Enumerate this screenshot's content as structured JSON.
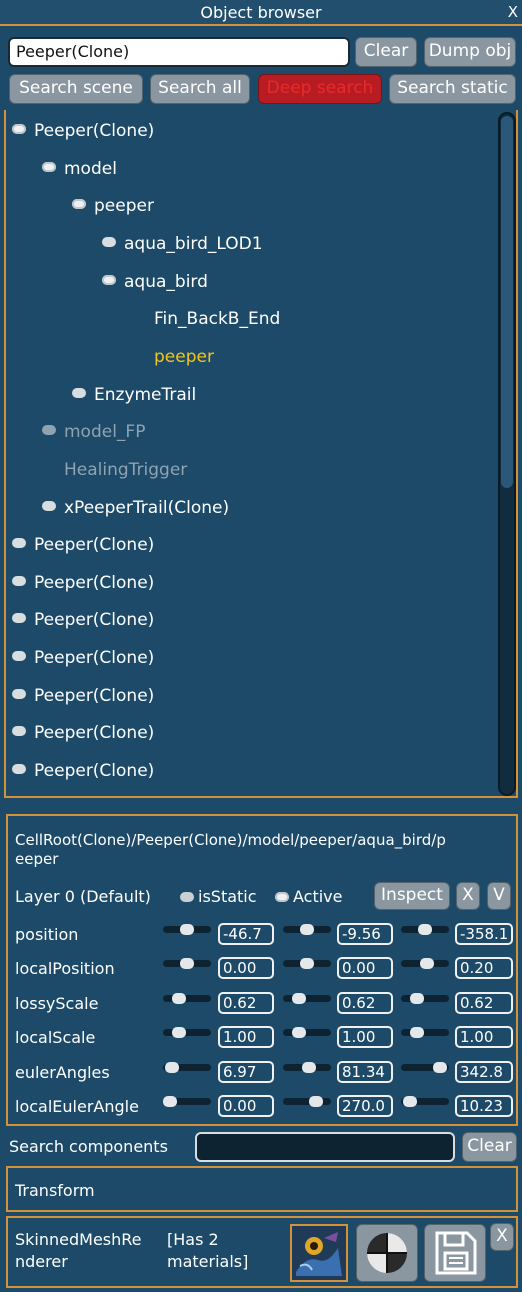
{
  "window": {
    "title": "Object browser",
    "close_label": "X"
  },
  "search": {
    "value": "Peeper(Clone)",
    "clear_label": "Clear",
    "dump_label": "Dump obj"
  },
  "modes": {
    "scene": "Search scene",
    "all": "Search all",
    "deep": "Deep search",
    "static": "Search static"
  },
  "tree": [
    {
      "label": "Peeper(Clone)",
      "level": 0,
      "check": "on",
      "style": "normal"
    },
    {
      "label": "model",
      "level": 1,
      "check": "on",
      "style": "normal"
    },
    {
      "label": "peeper",
      "level": 2,
      "check": "on",
      "style": "normal"
    },
    {
      "label": "aqua_bird_LOD1",
      "level": 3,
      "check": "off",
      "style": "normal"
    },
    {
      "label": "aqua_bird",
      "level": 3,
      "check": "on",
      "style": "normal"
    },
    {
      "label": "Fin_BackB_End",
      "level": 4,
      "check": "none",
      "style": "normal"
    },
    {
      "label": "peeper",
      "level": 4,
      "check": "none",
      "style": "selected"
    },
    {
      "label": "EnzymeTrail",
      "level": 2,
      "check": "off",
      "style": "normal"
    },
    {
      "label": "model_FP",
      "level": 1,
      "check": "off",
      "style": "inactive"
    },
    {
      "label": "HealingTrigger",
      "level": 1,
      "check": "none",
      "style": "inactive"
    },
    {
      "label": "xPeeperTrail(Clone)",
      "level": 1,
      "check": "off",
      "style": "normal"
    },
    {
      "label": "Peeper(Clone)",
      "level": 0,
      "check": "off",
      "style": "normal"
    },
    {
      "label": "Peeper(Clone)",
      "level": 0,
      "check": "off",
      "style": "normal"
    },
    {
      "label": "Peeper(Clone)",
      "level": 0,
      "check": "off",
      "style": "normal"
    },
    {
      "label": "Peeper(Clone)",
      "level": 0,
      "check": "off",
      "style": "normal"
    },
    {
      "label": "Peeper(Clone)",
      "level": 0,
      "check": "off",
      "style": "normal"
    },
    {
      "label": "Peeper(Clone)",
      "level": 0,
      "check": "off",
      "style": "normal"
    },
    {
      "label": "Peeper(Clone)",
      "level": 0,
      "check": "off",
      "style": "normal"
    }
  ],
  "inspector": {
    "path_line1": "CellRoot(Clone)/Peeper(Clone)/model/peeper/aqua_bird/p",
    "path_line2": "eeper",
    "layer": "Layer 0 (Default)",
    "is_static": "isStatic",
    "active": "Active",
    "inspect_label": "Inspect",
    "x_label": "X",
    "v_label": "V",
    "rows": [
      {
        "label": "position",
        "values": [
          "-46.7",
          "-9.56",
          "-358.1"
        ],
        "sliders": [
          0.5,
          0.5,
          0.5
        ]
      },
      {
        "label": "localPosition",
        "values": [
          "0.00",
          "0.00",
          "0.20"
        ],
        "sliders": [
          0.5,
          0.5,
          0.55
        ]
      },
      {
        "label": "lossyScale",
        "values": [
          "0.62",
          "0.62",
          "0.62"
        ],
        "sliders": [
          0.25,
          0.25,
          0.25
        ]
      },
      {
        "label": "localScale",
        "values": [
          "1.00",
          "1.00",
          "1.00"
        ],
        "sliders": [
          0.25,
          0.25,
          0.25
        ]
      },
      {
        "label": "eulerAngles",
        "values": [
          "6.97",
          "81.34",
          "342.8"
        ],
        "sliders": [
          0.05,
          0.55,
          0.95
        ]
      },
      {
        "label": "localEulerAngle",
        "values": [
          "0.00",
          "270.0",
          "10.23"
        ],
        "sliders": [
          0.0,
          0.75,
          0.05
        ]
      }
    ]
  },
  "components": {
    "search_label": "Search components",
    "search_value": "",
    "clear_label": "Clear",
    "transform_label": "Transform",
    "renderer_line1": "SkinnedMeshRe",
    "renderer_line2": "nderer",
    "materials_line1": "[Has 2",
    "materials_line2": "materials]",
    "remove_label": "X"
  },
  "colors": {
    "accent": "#d3923a",
    "selected": "#f5c518",
    "deep_search": "#b81c23"
  }
}
